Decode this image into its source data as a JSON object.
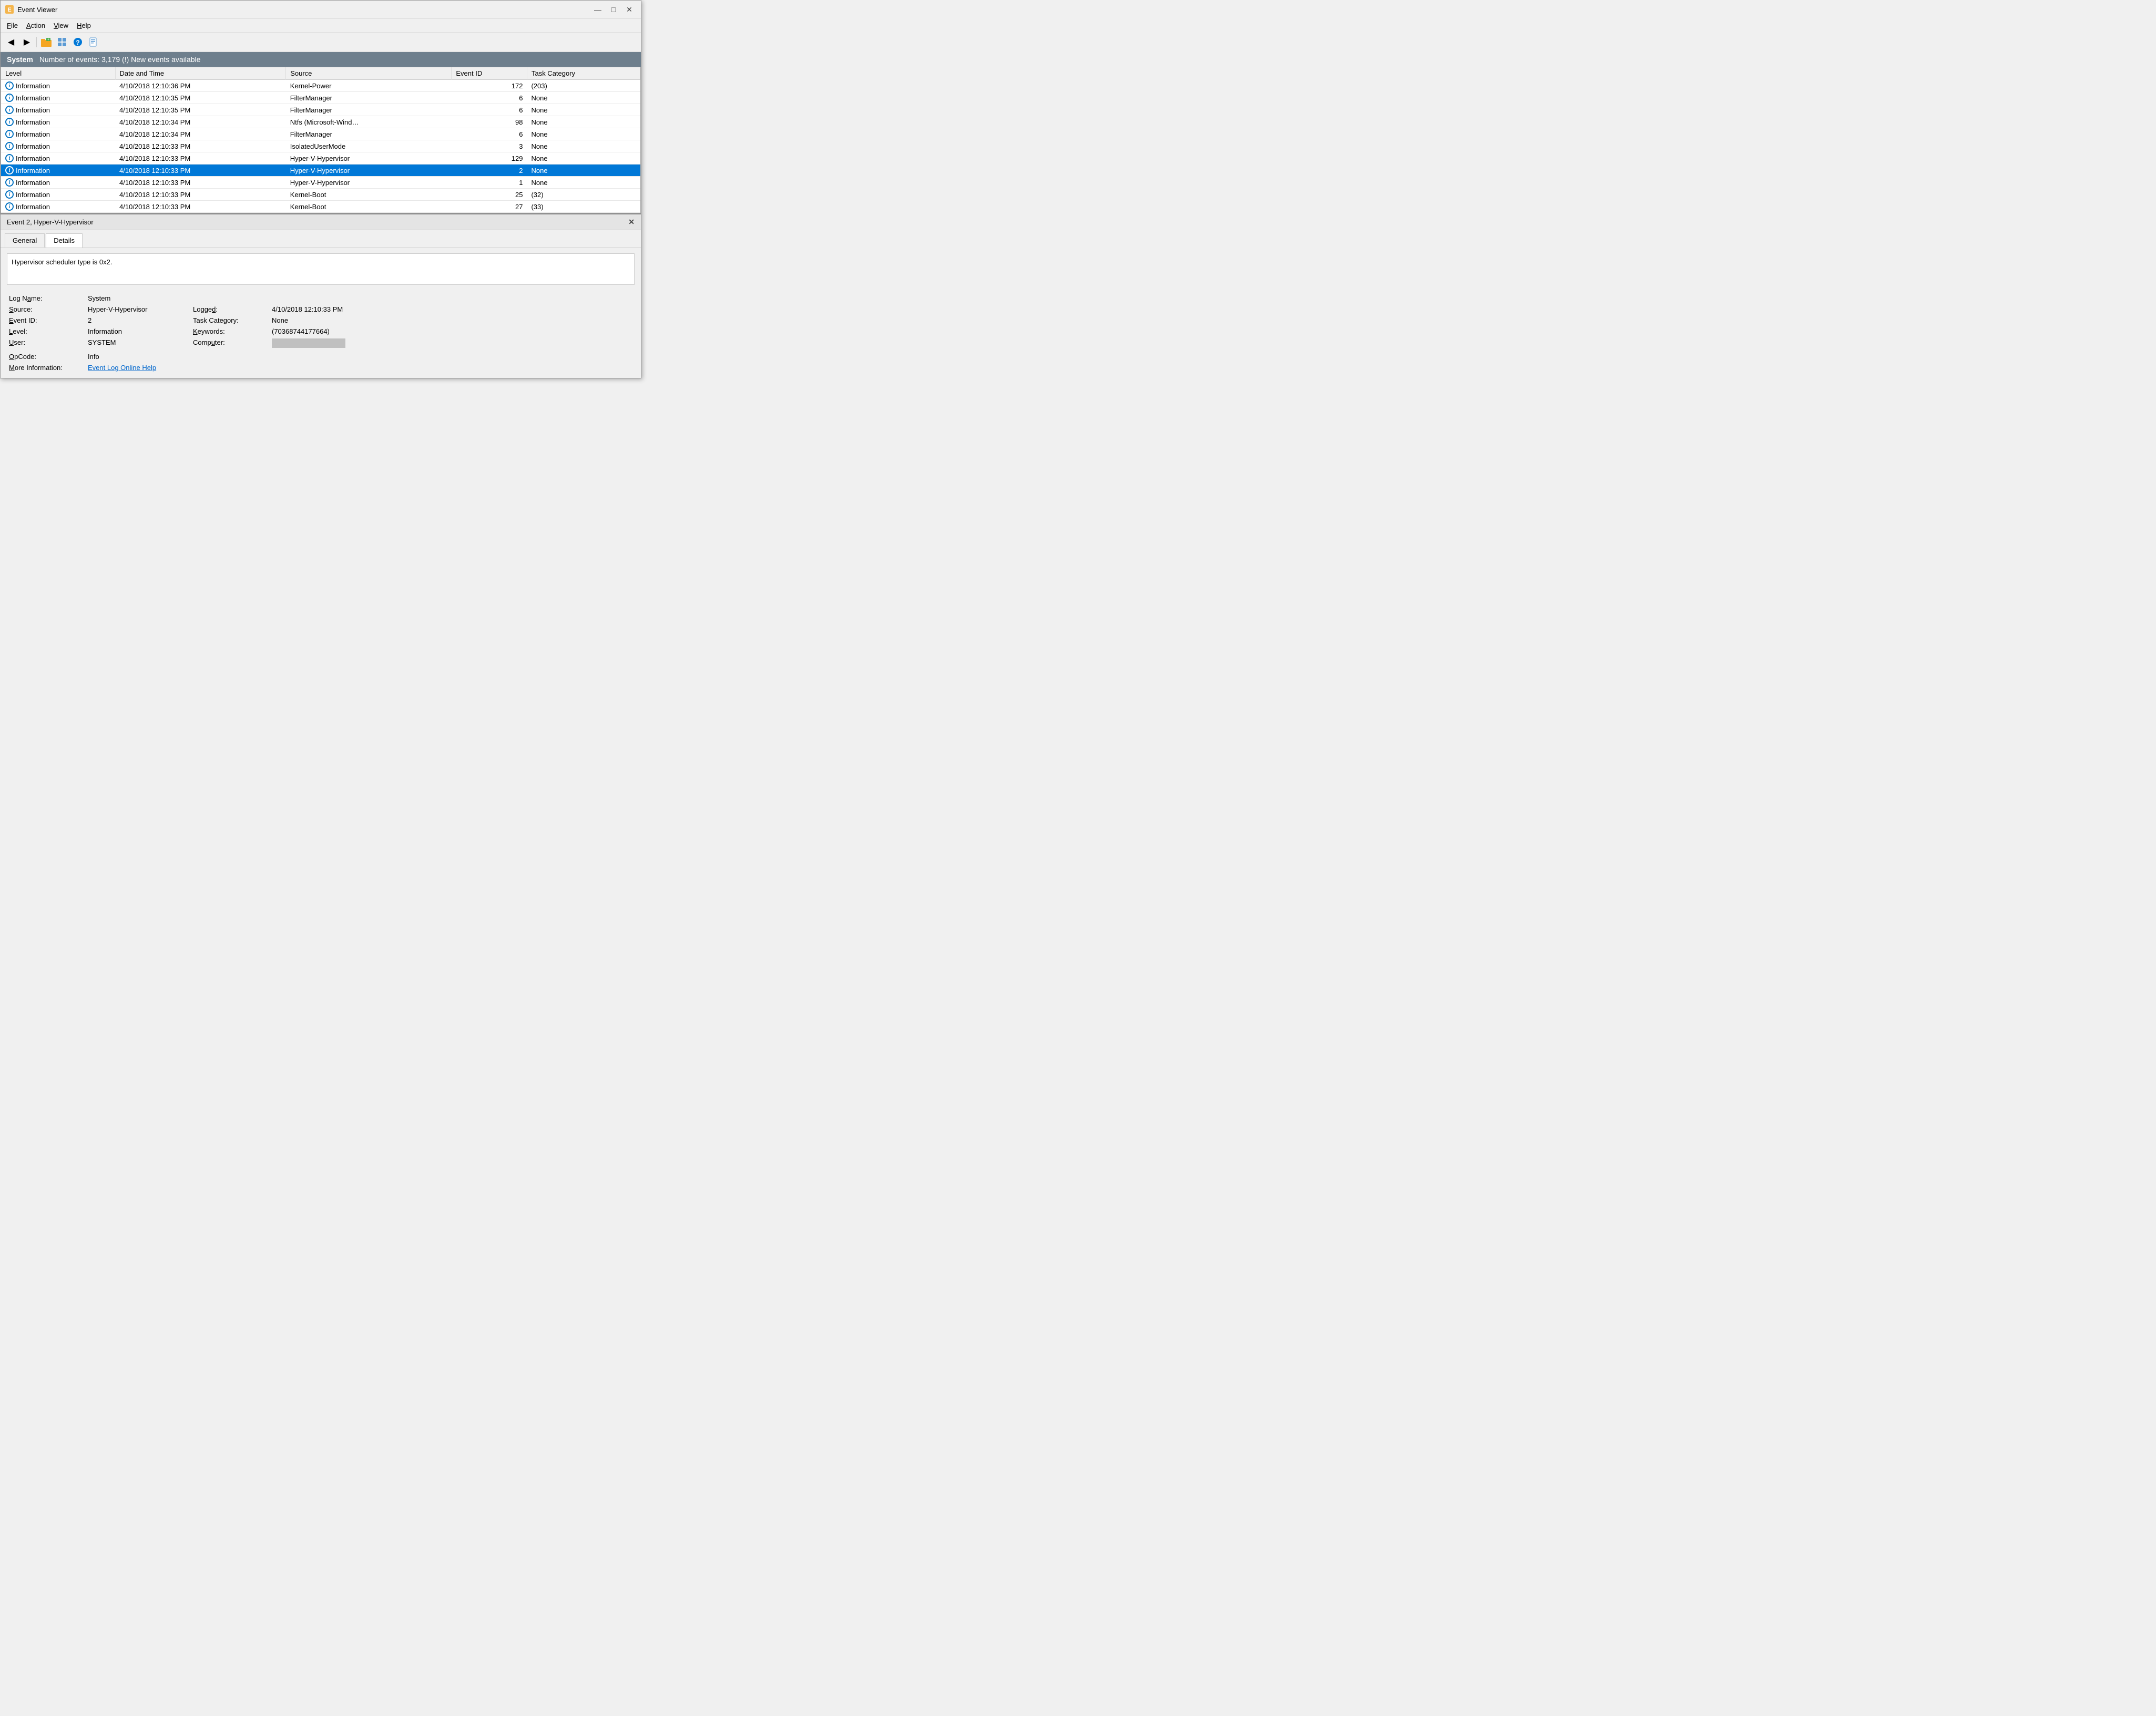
{
  "window": {
    "title": "Event Viewer",
    "controls": {
      "minimize": "—",
      "maximize": "□",
      "close": "✕"
    }
  },
  "menubar": {
    "items": [
      {
        "label": "File",
        "underline": "F"
      },
      {
        "label": "Action",
        "underline": "A"
      },
      {
        "label": "View",
        "underline": "V"
      },
      {
        "label": "Help",
        "underline": "H"
      }
    ]
  },
  "header": {
    "section": "System",
    "message": "Number of events: 3,179 (!) New events available"
  },
  "columns": [
    {
      "id": "level",
      "label": "Level"
    },
    {
      "id": "datetime",
      "label": "Date and Time"
    },
    {
      "id": "source",
      "label": "Source"
    },
    {
      "id": "eventid",
      "label": "Event ID"
    },
    {
      "id": "taskcategory",
      "label": "Task Category"
    }
  ],
  "events": [
    {
      "level": "Information",
      "datetime": "4/10/2018 12:10:36 PM",
      "source": "Kernel-Power",
      "eventid": "172",
      "taskcategory": "(203)",
      "selected": false
    },
    {
      "level": "Information",
      "datetime": "4/10/2018 12:10:35 PM",
      "source": "FilterManager",
      "eventid": "6",
      "taskcategory": "None",
      "selected": false
    },
    {
      "level": "Information",
      "datetime": "4/10/2018 12:10:35 PM",
      "source": "FilterManager",
      "eventid": "6",
      "taskcategory": "None",
      "selected": false
    },
    {
      "level": "Information",
      "datetime": "4/10/2018 12:10:34 PM",
      "source": "Ntfs (Microsoft-Wind…",
      "eventid": "98",
      "taskcategory": "None",
      "selected": false
    },
    {
      "level": "Information",
      "datetime": "4/10/2018 12:10:34 PM",
      "source": "FilterManager",
      "eventid": "6",
      "taskcategory": "None",
      "selected": false
    },
    {
      "level": "Information",
      "datetime": "4/10/2018 12:10:33 PM",
      "source": "IsolatedUserMode",
      "eventid": "3",
      "taskcategory": "None",
      "selected": false
    },
    {
      "level": "Information",
      "datetime": "4/10/2018 12:10:33 PM",
      "source": "Hyper-V-Hypervisor",
      "eventid": "129",
      "taskcategory": "None",
      "selected": false
    },
    {
      "level": "Information",
      "datetime": "4/10/2018 12:10:33 PM",
      "source": "Hyper-V-Hypervisor",
      "eventid": "2",
      "taskcategory": "None",
      "selected": true
    },
    {
      "level": "Information",
      "datetime": "4/10/2018 12:10:33 PM",
      "source": "Hyper-V-Hypervisor",
      "eventid": "1",
      "taskcategory": "None",
      "selected": false
    },
    {
      "level": "Information",
      "datetime": "4/10/2018 12:10:33 PM",
      "source": "Kernel-Boot",
      "eventid": "25",
      "taskcategory": "(32)",
      "selected": false
    },
    {
      "level": "Information",
      "datetime": "4/10/2018 12:10:33 PM",
      "source": "Kernel-Boot",
      "eventid": "27",
      "taskcategory": "(33)",
      "selected": false
    }
  ],
  "detail": {
    "title": "Event 2, Hyper-V-Hypervisor",
    "tabs": [
      {
        "label": "General",
        "active": true
      },
      {
        "label": "Details",
        "active": false
      }
    ],
    "description": "Hypervisor scheduler type is 0x2.",
    "meta": {
      "log_name_label": "Log Name:",
      "log_name_value": "System",
      "source_label": "Source:",
      "source_value": "Hyper-V-Hypervisor",
      "logged_label": "Logged:",
      "logged_value": "4/10/2018 12:10:33 PM",
      "event_id_label": "Event ID:",
      "event_id_value": "2",
      "task_category_label": "Task Category:",
      "task_category_value": "None",
      "level_label": "Level:",
      "level_value": "Information",
      "keywords_label": "Keywords:",
      "keywords_value": "(70368744177664)",
      "user_label": "User:",
      "user_value": "SYSTEM",
      "computer_label": "Computer:",
      "opcode_label": "OpCode:",
      "opcode_value": "Info",
      "more_info_label": "More Information:",
      "more_info_link": "Event Log Online Help"
    }
  }
}
